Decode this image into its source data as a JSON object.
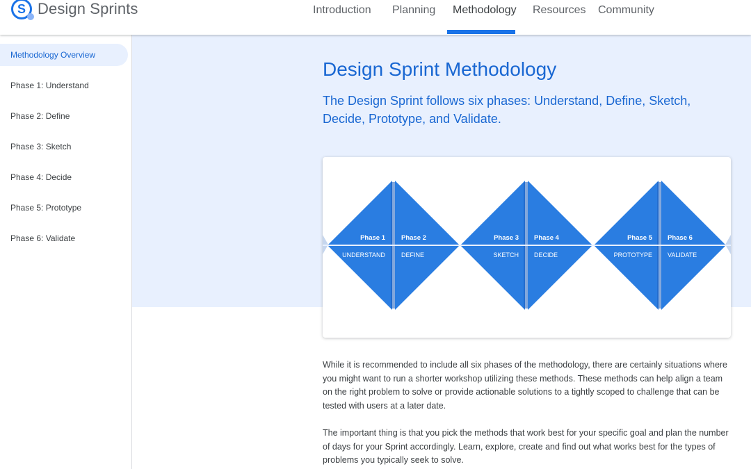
{
  "brand": {
    "name": "Design Sprints",
    "logo_letter": "S"
  },
  "nav": [
    {
      "label": "Introduction"
    },
    {
      "label": "Planning"
    },
    {
      "label": "Methodology"
    },
    {
      "label": "Resources"
    },
    {
      "label": "Community"
    }
  ],
  "nav_active": "Methodology",
  "sidebar": {
    "items": [
      {
        "label": "Methodology Overview"
      },
      {
        "label": "Phase 1: Understand"
      },
      {
        "label": "Phase 2: Define"
      },
      {
        "label": "Phase 3: Sketch"
      },
      {
        "label": "Phase 4: Decide"
      },
      {
        "label": "Phase 5: Prototype"
      },
      {
        "label": "Phase 6: Validate"
      }
    ],
    "active": "Methodology Overview"
  },
  "main": {
    "title": "Design Sprint Methodology",
    "subtitle": "The Design Sprint follows six phases: Understand, Define, Sketch, Decide, Prototype, and Validate.",
    "diagram": {
      "phases": [
        {
          "number": "Phase 1",
          "name": "UNDERSTAND"
        },
        {
          "number": "Phase 2",
          "name": "DEFINE"
        },
        {
          "number": "Phase 3",
          "name": "SKETCH"
        },
        {
          "number": "Phase 4",
          "name": "DECIDE"
        },
        {
          "number": "Phase 5",
          "name": "PROTOTYPE"
        },
        {
          "number": "Phase 6",
          "name": "VALIDATE"
        }
      ]
    },
    "paragraphs": [
      "While it is recommended to include all six phases of the methodology, there are certainly situations where you might want to run a shorter workshop utilizing these methods. These methods can help align a team on the right problem to solve or provide actionable solutions to a tightly scoped to challenge that can be tested with users at a later date.",
      "The important thing is that you pick the methods that work best for your specific goal and plan the number of days for your Sprint accordingly. Learn, explore, create and find out what works best for the types of problems you typically seek to solve."
    ]
  },
  "colors": {
    "accent": "#1a73e8",
    "diamond": "#2a7de1",
    "diamond_dark": "#1c5fc0",
    "hero_bg": "#e8f0fe"
  }
}
